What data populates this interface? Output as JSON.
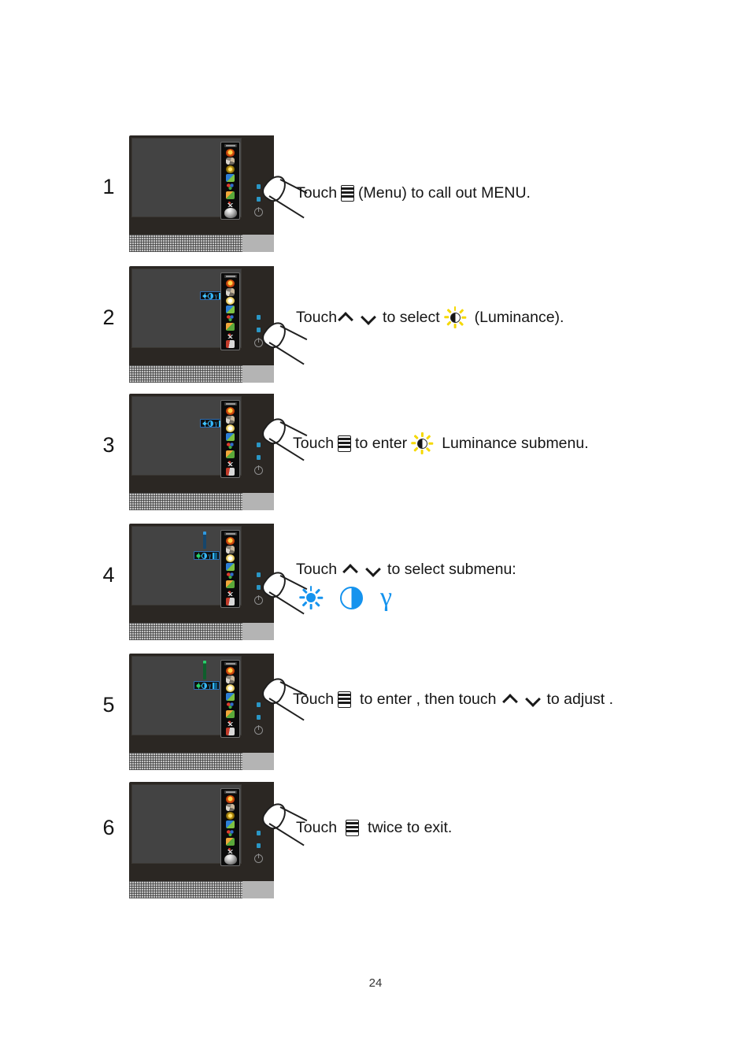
{
  "document": {
    "page_number": "24",
    "accent_blue": "#1593ee",
    "luminance_yellow": "#f5d800",
    "osd_menu_items": [
      "luminance-icon",
      "image-setup-icon",
      "color-setup-icon",
      "picture-boost-icon",
      "osd-setup-icon",
      "picture-mode-icon",
      "extra-icon",
      "exit-icon"
    ]
  },
  "steps": [
    {
      "number": "1",
      "monitor_state": "osd-main-menu-closed",
      "text_parts": [
        {
          "type": "text",
          "value": "Touch"
        },
        {
          "type": "icon",
          "value": "menu-button-icon"
        },
        {
          "type": "text",
          "value": "(Menu) to  call out MENU."
        }
      ],
      "plain_text": "Touch (Menu) to call out MENU."
    },
    {
      "number": "2",
      "monitor_state": "osd-submenu-row-visible",
      "text_parts": [
        {
          "type": "text",
          "value": "Touch"
        },
        {
          "type": "icon",
          "value": "chevron-up-icon"
        },
        {
          "type": "icon",
          "value": "chevron-down-icon"
        },
        {
          "type": "text",
          "value": "to select"
        },
        {
          "type": "icon",
          "value": "luminance-icon"
        },
        {
          "type": "text",
          "value": "(Luminance)."
        }
      ],
      "plain_text": "Touch ∧ ∨ to select (Luminance)."
    },
    {
      "number": "3",
      "monitor_state": "osd-luminance-highlighted",
      "text_parts": [
        {
          "type": "text",
          "value": "Touch"
        },
        {
          "type": "icon",
          "value": "menu-button-icon"
        },
        {
          "type": "text",
          "value": "to enter"
        },
        {
          "type": "icon",
          "value": "luminance-icon"
        },
        {
          "type": "text",
          "value": "Luminance  submenu."
        }
      ],
      "plain_text": "Touch to enter Luminance submenu."
    },
    {
      "number": "4",
      "monitor_state": "osd-submenu-slider-blue",
      "text_parts": [
        {
          "type": "text",
          "value": "Touch"
        },
        {
          "type": "icon",
          "value": "chevron-up-icon"
        },
        {
          "type": "icon",
          "value": "chevron-down-icon"
        },
        {
          "type": "text",
          "value": "to select submenu:"
        }
      ],
      "plain_text": "Touch ∧ ∨ to select submenu:",
      "submenu_icons": [
        {
          "name": "brightness-icon",
          "glyph": "sun"
        },
        {
          "name": "contrast-icon",
          "glyph": "half-circle"
        },
        {
          "name": "gamma-icon",
          "glyph": "γ"
        }
      ]
    },
    {
      "number": "5",
      "monitor_state": "osd-submenu-slider-green",
      "text_parts": [
        {
          "type": "text",
          "value": "Touch"
        },
        {
          "type": "icon",
          "value": "menu-button-icon"
        },
        {
          "type": "text",
          "value": "to enter ,  then touch"
        },
        {
          "type": "icon",
          "value": "chevron-up-icon"
        },
        {
          "type": "icon",
          "value": "chevron-down-icon"
        },
        {
          "type": "text",
          "value": "to  adjust ."
        }
      ],
      "plain_text": "Touch to enter , then touch ∧ ∨ to adjust ."
    },
    {
      "number": "6",
      "monitor_state": "osd-main-menu-closed",
      "text_parts": [
        {
          "type": "text",
          "value": "Touch"
        },
        {
          "type": "icon",
          "value": "menu-button-icon"
        },
        {
          "type": "text",
          "value": "twice to exit."
        }
      ],
      "plain_text": "Touch twice to exit."
    }
  ]
}
